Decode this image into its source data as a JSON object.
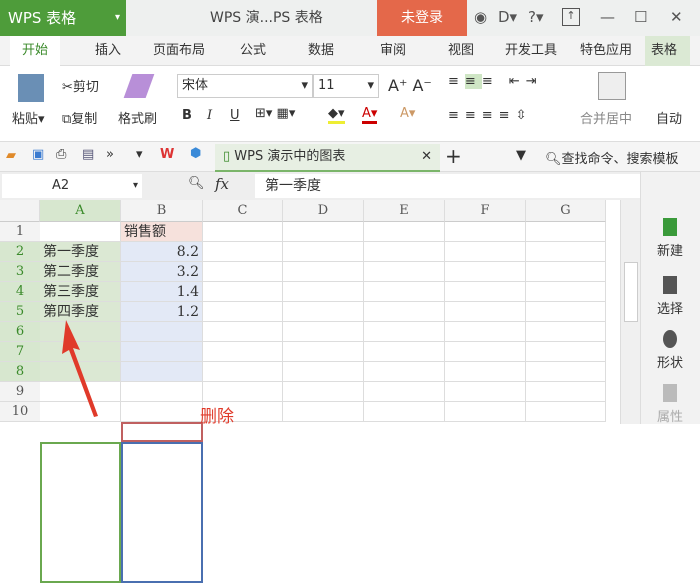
{
  "titlebar": {
    "app": "WPS 表格",
    "document": "WPS 演...PS 表格",
    "login": "未登录",
    "help": "?"
  },
  "tabs": [
    "开始",
    "插入",
    "页面布局",
    "公式",
    "数据",
    "审阅",
    "视图",
    "开发工具",
    "特色应用",
    "表格"
  ],
  "ribbon": {
    "paste": "粘贴",
    "cut": "剪切",
    "copy": "复制",
    "format_painter": "格式刷",
    "font": "宋体",
    "font_size": "11",
    "bold": "B",
    "italic": "I",
    "underline": "U",
    "merge": "合并居中",
    "autowrap": "自动"
  },
  "quickbar": {
    "doc_tab": "WPS 演示中的图表",
    "search": "查找命令、搜索模板"
  },
  "formula_bar": {
    "name_box": "A2",
    "fx": "fx",
    "value": "第一季度"
  },
  "sheet": {
    "columns": [
      "A",
      "B",
      "C",
      "D",
      "E",
      "F",
      "G"
    ],
    "rows": [
      "1",
      "2",
      "3",
      "4",
      "5",
      "6",
      "7",
      "8",
      "9",
      "10"
    ],
    "cells": {
      "B1": "销售额",
      "A2": "第一季度",
      "B2": "8.2",
      "A3": "第二季度",
      "B3": "3.2",
      "A4": "第三季度",
      "B4": "1.4",
      "A5": "第四季度",
      "B5": "1.2"
    }
  },
  "annotation": "删除",
  "right_pane": [
    "新建",
    "选择",
    "形状",
    "属性"
  ]
}
